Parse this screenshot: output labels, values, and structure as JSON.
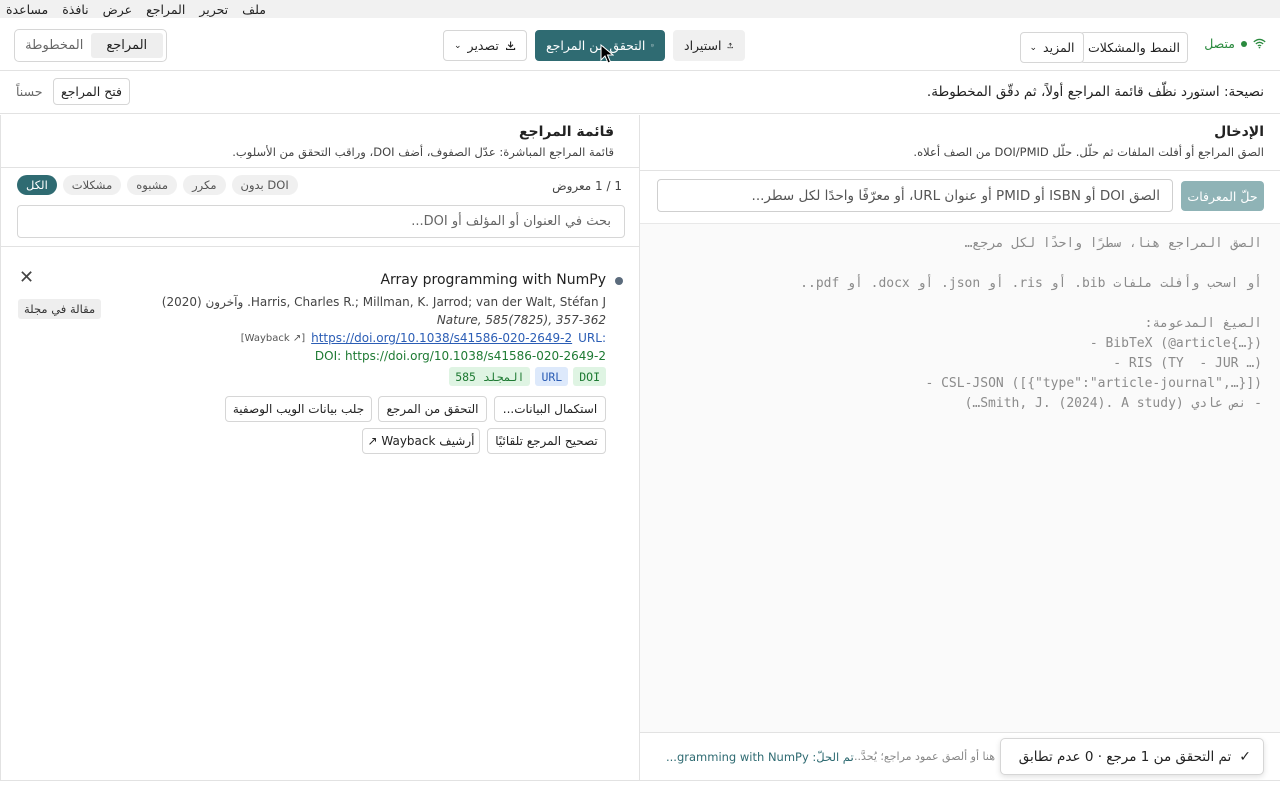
{
  "menubar": [
    "ملف",
    "تحرير",
    "المراجع",
    "عرض",
    "نافذة",
    "مساعدة"
  ],
  "toolbar": {
    "status": "متصل",
    "style_issues": "النمط والمشكلات",
    "more": "المزيد",
    "import": "استيراد",
    "verify": "التحقق من المراجع",
    "export": "تصدير",
    "tab_references": "المراجع",
    "tab_manuscript": "المخطوطة",
    "active_tab": "المراجع"
  },
  "tip": {
    "text": "نصيحة: استورد نظّف قائمة المراجع أولاً، ثم دقّق المخطوطة.",
    "open_refs": "فتح المراجع",
    "ok": "حسناً"
  },
  "input_panel": {
    "title": "الإدخال",
    "subtitle": "الصق المراجع أو أفلت الملفات ثم حلّل. حلّل DOI/PMID من الصف أعلاه.",
    "resolve_button": "حلّ المعرفات",
    "id_placeholder": "الصق DOI أو ISBN أو PMID أو عنوان URL، أو معرّفًا واحدًا لكل سطر...",
    "editor_lines": [
      "الصق المراجع هنا، سطرًا واحدًا لكل مرجع…",
      "أو اسحب وأفلت ملفات bib. أو ris. أو json. أو docx. أو pdf..",
      "الصيغ المدعومة:",
      "- BibTeX (@article{…})",
      "- RIS (TY  - JUR …)",
      "- CSL-JSON ([{\"type\":\"article-journal\",…}])",
      "- نص عادي (Smith, J. (2024). A study…)"
    ],
    "footer_hint": "هنا أو ألصق عمود مراجع؛ يُحدَّ...",
    "footer_resolved": "تم الحلّ: gramming with NumPy..."
  },
  "refs_panel": {
    "title": "قائمة المراجع",
    "subtitle": "قائمة المراجع المباشرة: عدّل الصفوف، أضف DOI، وراقب التحقق من الأسلوب.",
    "count": "1 / 1 معروض",
    "filters": [
      "الكل",
      "مشكلات",
      "مشبوه",
      "مكرر",
      "بدون DOI"
    ],
    "active_filter": "الكل",
    "search_placeholder": "بحث في العنوان أو المؤلف أو DOI...",
    "item": {
      "title": "Array programming with NumPy",
      "authors": "Harris, Charles R.; Millman, K. Jarrod; van der Walt, Stéfan J. وآخرون (2020)",
      "journal": "Nature, 585(7825), 357-362",
      "url_label": "URL:",
      "url": "https://doi.org/10.1038/s41586-020-2649-2",
      "wayback_link": "[Wayback ↗]",
      "doi_line": "DOI: https://doi.org/10.1038/s41586-020-2649-2",
      "tags": [
        "DOI",
        "URL",
        "المجلد 585"
      ],
      "type": "مقالة في مجلة",
      "actions": [
        "استكمال البيانات...",
        "التحقق من المرجع",
        "جلب بيانات الويب الوصفية",
        "تصحيح المرجع تلقائيًا",
        "أرشيف Wayback ↗"
      ]
    }
  },
  "toast": {
    "message": "تم التحقق من 1 مرجع · 0 عدم تطابق"
  },
  "colors": {
    "accent": "#2f6b72",
    "success": "#2a8a3e",
    "link": "#2b5db5"
  }
}
